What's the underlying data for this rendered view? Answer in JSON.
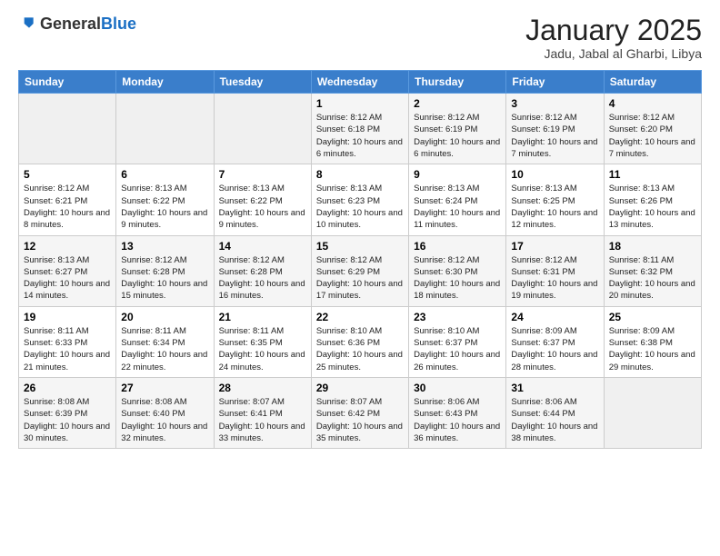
{
  "header": {
    "logo_general": "General",
    "logo_blue": "Blue",
    "title": "January 2025",
    "subtitle": "Jadu, Jabal al Gharbi, Libya"
  },
  "weekdays": [
    "Sunday",
    "Monday",
    "Tuesday",
    "Wednesday",
    "Thursday",
    "Friday",
    "Saturday"
  ],
  "weeks": [
    [
      {
        "day": "",
        "detail": ""
      },
      {
        "day": "",
        "detail": ""
      },
      {
        "day": "",
        "detail": ""
      },
      {
        "day": "1",
        "detail": "Sunrise: 8:12 AM\nSunset: 6:18 PM\nDaylight: 10 hours\nand 6 minutes."
      },
      {
        "day": "2",
        "detail": "Sunrise: 8:12 AM\nSunset: 6:19 PM\nDaylight: 10 hours\nand 6 minutes."
      },
      {
        "day": "3",
        "detail": "Sunrise: 8:12 AM\nSunset: 6:19 PM\nDaylight: 10 hours\nand 7 minutes."
      },
      {
        "day": "4",
        "detail": "Sunrise: 8:12 AM\nSunset: 6:20 PM\nDaylight: 10 hours\nand 7 minutes."
      }
    ],
    [
      {
        "day": "5",
        "detail": "Sunrise: 8:12 AM\nSunset: 6:21 PM\nDaylight: 10 hours\nand 8 minutes."
      },
      {
        "day": "6",
        "detail": "Sunrise: 8:13 AM\nSunset: 6:22 PM\nDaylight: 10 hours\nand 9 minutes."
      },
      {
        "day": "7",
        "detail": "Sunrise: 8:13 AM\nSunset: 6:22 PM\nDaylight: 10 hours\nand 9 minutes."
      },
      {
        "day": "8",
        "detail": "Sunrise: 8:13 AM\nSunset: 6:23 PM\nDaylight: 10 hours\nand 10 minutes."
      },
      {
        "day": "9",
        "detail": "Sunrise: 8:13 AM\nSunset: 6:24 PM\nDaylight: 10 hours\nand 11 minutes."
      },
      {
        "day": "10",
        "detail": "Sunrise: 8:13 AM\nSunset: 6:25 PM\nDaylight: 10 hours\nand 12 minutes."
      },
      {
        "day": "11",
        "detail": "Sunrise: 8:13 AM\nSunset: 6:26 PM\nDaylight: 10 hours\nand 13 minutes."
      }
    ],
    [
      {
        "day": "12",
        "detail": "Sunrise: 8:13 AM\nSunset: 6:27 PM\nDaylight: 10 hours\nand 14 minutes."
      },
      {
        "day": "13",
        "detail": "Sunrise: 8:12 AM\nSunset: 6:28 PM\nDaylight: 10 hours\nand 15 minutes."
      },
      {
        "day": "14",
        "detail": "Sunrise: 8:12 AM\nSunset: 6:28 PM\nDaylight: 10 hours\nand 16 minutes."
      },
      {
        "day": "15",
        "detail": "Sunrise: 8:12 AM\nSunset: 6:29 PM\nDaylight: 10 hours\nand 17 minutes."
      },
      {
        "day": "16",
        "detail": "Sunrise: 8:12 AM\nSunset: 6:30 PM\nDaylight: 10 hours\nand 18 minutes."
      },
      {
        "day": "17",
        "detail": "Sunrise: 8:12 AM\nSunset: 6:31 PM\nDaylight: 10 hours\nand 19 minutes."
      },
      {
        "day": "18",
        "detail": "Sunrise: 8:11 AM\nSunset: 6:32 PM\nDaylight: 10 hours\nand 20 minutes."
      }
    ],
    [
      {
        "day": "19",
        "detail": "Sunrise: 8:11 AM\nSunset: 6:33 PM\nDaylight: 10 hours\nand 21 minutes."
      },
      {
        "day": "20",
        "detail": "Sunrise: 8:11 AM\nSunset: 6:34 PM\nDaylight: 10 hours\nand 22 minutes."
      },
      {
        "day": "21",
        "detail": "Sunrise: 8:11 AM\nSunset: 6:35 PM\nDaylight: 10 hours\nand 24 minutes."
      },
      {
        "day": "22",
        "detail": "Sunrise: 8:10 AM\nSunset: 6:36 PM\nDaylight: 10 hours\nand 25 minutes."
      },
      {
        "day": "23",
        "detail": "Sunrise: 8:10 AM\nSunset: 6:37 PM\nDaylight: 10 hours\nand 26 minutes."
      },
      {
        "day": "24",
        "detail": "Sunrise: 8:09 AM\nSunset: 6:37 PM\nDaylight: 10 hours\nand 28 minutes."
      },
      {
        "day": "25",
        "detail": "Sunrise: 8:09 AM\nSunset: 6:38 PM\nDaylight: 10 hours\nand 29 minutes."
      }
    ],
    [
      {
        "day": "26",
        "detail": "Sunrise: 8:08 AM\nSunset: 6:39 PM\nDaylight: 10 hours\nand 30 minutes."
      },
      {
        "day": "27",
        "detail": "Sunrise: 8:08 AM\nSunset: 6:40 PM\nDaylight: 10 hours\nand 32 minutes."
      },
      {
        "day": "28",
        "detail": "Sunrise: 8:07 AM\nSunset: 6:41 PM\nDaylight: 10 hours\nand 33 minutes."
      },
      {
        "day": "29",
        "detail": "Sunrise: 8:07 AM\nSunset: 6:42 PM\nDaylight: 10 hours\nand 35 minutes."
      },
      {
        "day": "30",
        "detail": "Sunrise: 8:06 AM\nSunset: 6:43 PM\nDaylight: 10 hours\nand 36 minutes."
      },
      {
        "day": "31",
        "detail": "Sunrise: 8:06 AM\nSunset: 6:44 PM\nDaylight: 10 hours\nand 38 minutes."
      },
      {
        "day": "",
        "detail": ""
      }
    ]
  ]
}
